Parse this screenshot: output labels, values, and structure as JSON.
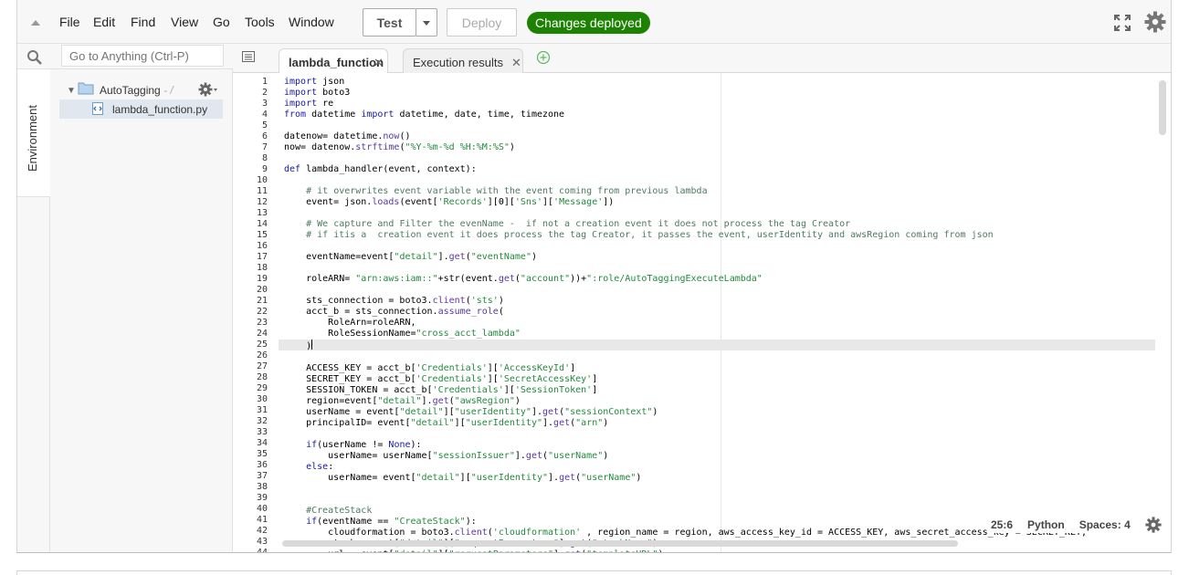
{
  "menubar": {
    "items": [
      "File",
      "Edit",
      "Find",
      "View",
      "Go",
      "Tools",
      "Window"
    ],
    "test_label": "Test",
    "deploy_label": "Deploy",
    "status_badge": "Changes deployed"
  },
  "sidebar": {
    "vertical_tab": "Environment",
    "search_placeholder": "Go to Anything (Ctrl-P)",
    "folder": {
      "name": "AutoTagging",
      "path": "- /"
    },
    "file": {
      "name": "lambda_function.py"
    }
  },
  "tabs": [
    {
      "label": "lambda_function",
      "active": true
    },
    {
      "label": "Execution results",
      "active": false
    }
  ],
  "editor": {
    "current_line": 25,
    "line_numbers": [
      1,
      2,
      3,
      4,
      5,
      6,
      7,
      8,
      9,
      10,
      11,
      12,
      13,
      14,
      15,
      16,
      17,
      18,
      19,
      20,
      21,
      22,
      23,
      24,
      25,
      26,
      27,
      28,
      29,
      30,
      31,
      32,
      33,
      34,
      35,
      36,
      37,
      38,
      39,
      40,
      41,
      42,
      43,
      44
    ],
    "lines": [
      "import json",
      "import boto3",
      "import re",
      "from datetime import datetime, date, time, timezone",
      "",
      "datenow= datetime.now()",
      "now= datenow.strftime(\"%Y-%m-%d %H:%M:%S\")",
      "",
      "def lambda_handler(event, context):",
      "",
      "    # it overwrites event variable with the event coming from previous lambda",
      "    event= json.loads(event['Records'][0]['Sns']['Message'])",
      "",
      "    # We capture and Filter the evenName -  if not a creation event it does not process the tag Creator",
      "    # if itis a  creation event it does process the tag Creator, it passes the event, userIdentity and awsRegion coming from json",
      "",
      "    eventName=event[\"detail\"].get(\"eventName\")",
      "",
      "    roleARN= \"arn:aws:iam::\"+str(event.get(\"account\"))+\":role/AutoTaggingExecuteLambda\"",
      "",
      "    sts_connection = boto3.client('sts')",
      "    acct_b = sts_connection.assume_role(",
      "        RoleArn=roleARN,",
      "        RoleSessionName=\"cross_acct_lambda\"",
      "    )",
      "",
      "    ACCESS_KEY = acct_b['Credentials']['AccessKeyId']",
      "    SECRET_KEY = acct_b['Credentials']['SecretAccessKey']",
      "    SESSION_TOKEN = acct_b['Credentials']['SessionToken']",
      "    region=event[\"detail\"].get(\"awsRegion\")",
      "    userName = event[\"detail\"][\"userIdentity\"].get(\"sessionContext\")",
      "    principalID= event[\"detail\"][\"userIdentity\"].get(\"arn\")",
      "",
      "    if(userName != None):",
      "        userName= userName[\"sessionIssuer\"].get(\"userName\")",
      "    else:",
      "        userName= event[\"detail\"][\"userIdentity\"].get(\"userName\")",
      "",
      "",
      "    #CreateStack",
      "    if(eventName == \"CreateStack\"):",
      "        cloudformation = boto3.client('cloudformation' , region_name = region, aws_access_key_id = ACCESS_KEY, aws_secret_access_key = SECRET_KEY,",
      "        stack= event[\"detail\"][\"requestParameters\"].get(\"stackName\")",
      "        url = event[\"detail\"][\"requestParameters\"].get(\"templateURL\")"
    ]
  },
  "status": {
    "position": "25:6",
    "language": "Python",
    "indent": "Spaces: 4"
  },
  "colors": {
    "badge": "#1d8102",
    "keyword": "#1a1aa6",
    "string": "#248a3d",
    "comment": "#4f7a60"
  }
}
